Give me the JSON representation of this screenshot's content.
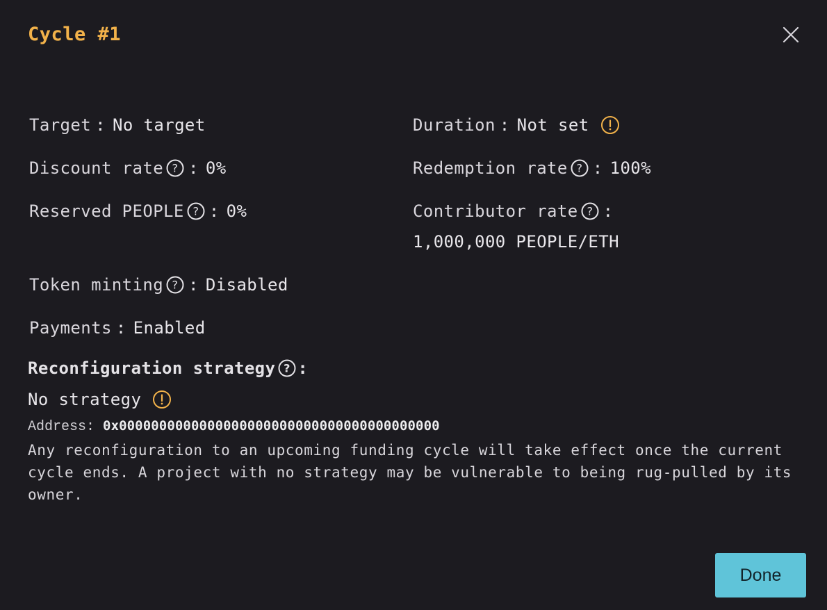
{
  "modal": {
    "title": "Cycle #1",
    "close_icon": "close-icon",
    "done_label": "Done"
  },
  "colors": {
    "accent": "#f2b24a",
    "button": "#5fc4d9",
    "background": "#1c1b20",
    "text": "#e6e4e8"
  },
  "fields": {
    "target": {
      "label": "Target",
      "value": "No target"
    },
    "duration": {
      "label": "Duration",
      "value": "Not set",
      "icon": "warning-icon"
    },
    "discount_rate": {
      "label": "Discount rate",
      "value": "0%",
      "icon": "help-icon"
    },
    "redemption_rate": {
      "label": "Redemption rate",
      "value": "100%",
      "icon": "help-icon"
    },
    "reserved": {
      "label": "Reserved PEOPLE",
      "value": "0%",
      "icon": "help-icon"
    },
    "contributor_rate": {
      "label": "Contributor rate",
      "value": "1,000,000 PEOPLE/ETH",
      "icon": "help-icon"
    },
    "token_minting": {
      "label": "Token minting",
      "value": "Disabled",
      "icon": "help-icon"
    },
    "payments": {
      "label": "Payments",
      "value": "Enabled"
    }
  },
  "reconfiguration": {
    "label": "Reconfiguration strategy",
    "value": "No strategy",
    "address_label": "Address:",
    "address": "0x0000000000000000000000000000000000000000",
    "description": "Any reconfiguration to an upcoming funding cycle will take effect once the current cycle ends. A project with no strategy may be vulnerable to being rug-pulled by its owner."
  }
}
